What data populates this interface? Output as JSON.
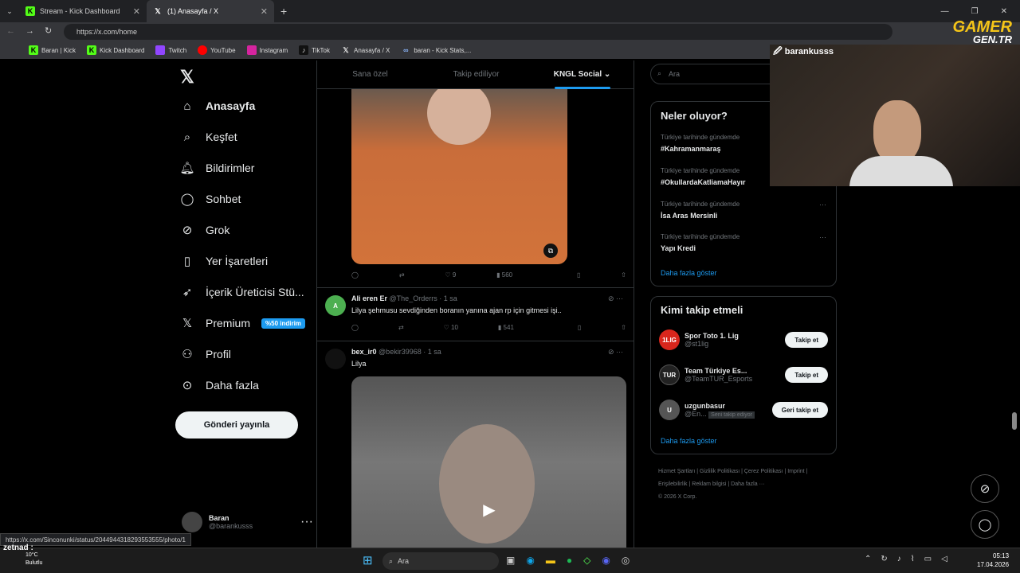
{
  "browser": {
    "tabs": [
      {
        "label": "Stream - Kick Dashboard",
        "icon": "kick-icon"
      },
      {
        "label": "(1) Anasayfa / X",
        "icon": "x-icon"
      }
    ],
    "url": "https://x.com/home",
    "bookmarks": [
      "Baran | Kick",
      "Kick Dashboard",
      "Twitch",
      "YouTube",
      "Instagram",
      "TikTok",
      "Anasayfa / X",
      "baran - Kick Stats,..."
    ],
    "status_url": "https://x.com/Sinconunki/status/2044944318293553555/photo/1"
  },
  "nav": {
    "items": [
      {
        "label": "Anasayfa",
        "icon": "home-icon"
      },
      {
        "label": "Keşfet",
        "icon": "search-icon"
      },
      {
        "label": "Bildirimler",
        "icon": "bell-icon"
      },
      {
        "label": "Sohbet",
        "icon": "chat-icon"
      },
      {
        "label": "Grok",
        "icon": "grok-icon"
      },
      {
        "label": "Yer İşaretleri",
        "icon": "bookmark-icon"
      },
      {
        "label": "İçerik Üreticisi Stü...",
        "icon": "rocket-icon"
      },
      {
        "label": "Premium",
        "icon": "x-icon"
      },
      {
        "label": "Profil",
        "icon": "user-icon"
      },
      {
        "label": "Daha fazla",
        "icon": "more-icon"
      }
    ],
    "premium_badge": "%50 indirim",
    "post_button": "Gönderi yayınla",
    "profile": {
      "name": "Baran",
      "handle": "@barankusss"
    }
  },
  "feed": {
    "tabs": [
      "Sana özel",
      "Takip ediliyor",
      "KNGL Social"
    ],
    "post1": {
      "likes": "9",
      "views": "560"
    },
    "post2": {
      "author": "Ali eren Er",
      "handle": "@The_Orderrs",
      "time": "· 1 sa",
      "text": "Lilya şehmusu sevdiğinden boranın yanına ajan rp için gitmesi işi..",
      "likes": "10",
      "views": "541",
      "avatar": "A"
    },
    "post3": {
      "author": "bex_ir0",
      "handle": "@bekir39968",
      "time": "· 1 sa",
      "text": "Lilya"
    }
  },
  "right": {
    "search_placeholder": "Ara",
    "trends_title": "Neler oluyor?",
    "trends": [
      {
        "context": "Türkiye tarihinde gündemde",
        "name": "#Kahramanmaraş"
      },
      {
        "context": "Türkiye tarihinde gündemde",
        "name": "#OkullardaKatliamaHayır"
      },
      {
        "context": "Türkiye tarihinde gündemde",
        "name": "İsa Aras Mersinli"
      },
      {
        "context": "Türkiye tarihinde gündemde",
        "name": "Yapı Kredi"
      }
    ],
    "show_more": "Daha fazla göster",
    "follow_title": "Kimi takip etmeli",
    "follows": [
      {
        "name": "Spor Toto 1. Lig",
        "handle": "@st1lig",
        "button": "Takip et",
        "avatar": "1LIG",
        "color": "#d9261c"
      },
      {
        "name": "Team Türkiye Es...",
        "handle": "@TeamTUR_Esports",
        "button": "Takip et",
        "avatar": "TUR",
        "color": "#222"
      },
      {
        "name": "uzgunbasur",
        "handle": "@En...",
        "button": "Geri takip et",
        "avatar": "U",
        "color": "#555",
        "note": "Seni takip ediyor"
      }
    ],
    "footer": "Hizmet Şartları  |  Gizlilik Politikası  |  Çerez Politikası  |  Imprint  |  Erişilebilirlik  |  Reklam bilgisi  |  Daha fazla ···",
    "copyright": "© 2026 X Corp."
  },
  "overlay": {
    "streamer": "barankusss",
    "logo1": "GAMER",
    "logo2": "GEN.TR"
  },
  "taskbar": {
    "search": "Ara",
    "time": "05:13",
    "date": "17.04.2026",
    "weather": "10°C",
    "weather_text": "Bulutlu",
    "chat_user": "zetnad :"
  }
}
